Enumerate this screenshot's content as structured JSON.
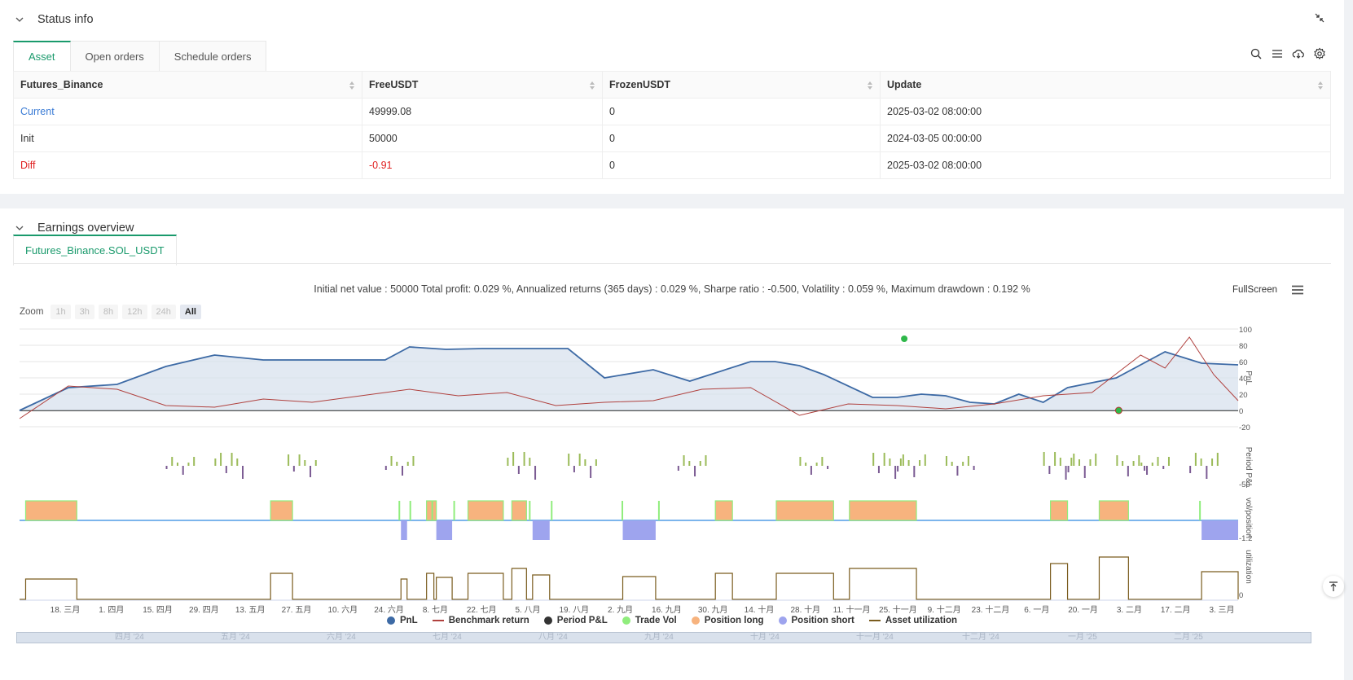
{
  "status_panel": {
    "title": "Status info",
    "tabs": [
      {
        "label": "Asset",
        "active": true
      },
      {
        "label": "Open orders",
        "active": false
      },
      {
        "label": "Schedule orders",
        "active": false
      }
    ],
    "toolbar_icons": [
      "search-icon",
      "list-icon",
      "cloud-download-icon",
      "gear-icon"
    ],
    "table": {
      "columns": [
        "Futures_Binance",
        "FreeUSDT",
        "FrozenUSDT",
        "Update"
      ],
      "rows": [
        {
          "label": "Current",
          "free": "49999.08",
          "frozen": "0",
          "update": "2025-03-02 08:00:00"
        },
        {
          "label": "Init",
          "free": "50000",
          "frozen": "0",
          "update": "2024-03-05 00:00:00"
        },
        {
          "label": "Diff",
          "free": "-0.91",
          "frozen": "0",
          "update": "2025-03-02 08:00:00"
        }
      ]
    }
  },
  "earnings_panel": {
    "title": "Earnings overview",
    "tab": "Futures_Binance.SOL_USDT",
    "summary": "Initial net value : 50000 Total profit: 0.029 %, Annualized returns (365 days) : 0.029 %, Sharpe ratio : -0.500, Volatility : 0.059 %, Maximum drawdown : 0.192 %",
    "fullscreen_label": "FullScreen",
    "zoom": {
      "label": "Zoom",
      "buttons": [
        "1h",
        "3h",
        "8h",
        "12h",
        "24h",
        "All"
      ],
      "active": "All"
    }
  },
  "colors": {
    "accent": "#1a9a6c",
    "pnl": "#3d6aa5",
    "benchmark": "#b0413e",
    "period_pos": "#9bbb59",
    "period_neg": "#7b5b93",
    "trade_vol": "#90ed7d",
    "position_long": "#f7b37e",
    "position_short": "#9ea4ee",
    "utilization": "#7a5c1e"
  },
  "chart_data": {
    "type": "line",
    "x_ticks": [
      "18. 三月",
      "1. 四月",
      "15. 四月",
      "29. 四月",
      "13. 五月",
      "27. 五月",
      "10. 六月",
      "24. 六月",
      "8. 七月",
      "22. 七月",
      "5. 八月",
      "19. 八月",
      "2. 九月",
      "16. 九月",
      "30. 九月",
      "14. 十月",
      "28. 十月",
      "11. 十一月",
      "25. 十一月",
      "9. 十二月",
      "23. 十二月",
      "6. 一月",
      "20. 一月",
      "3. 二月",
      "17. 二月",
      "3. 三月"
    ],
    "panes": [
      {
        "name": "PnL",
        "ylim": [
          -20,
          100
        ],
        "ticks": [
          "100",
          "80",
          "60",
          "40",
          "20",
          "0",
          "-20"
        ]
      },
      {
        "name": "Period P&L",
        "ticks": [
          "-50"
        ]
      },
      {
        "name": "vol/position",
        "ticks": [
          "-1.2"
        ]
      },
      {
        "name": "utilization",
        "ticks": [
          "0"
        ]
      }
    ],
    "series": [
      {
        "name": "PnL",
        "x": [
          0,
          4,
          8,
          12,
          16,
          20,
          22,
          26,
          28,
          30,
          32,
          35,
          38,
          40,
          42,
          45,
          48,
          52,
          55,
          60,
          62,
          64,
          66,
          70,
          72,
          74,
          76,
          78,
          80,
          82,
          84,
          86,
          90,
          94,
          97,
          100
        ],
        "y": [
          0,
          28,
          32,
          54,
          68,
          62,
          62,
          62,
          62,
          62,
          78,
          75,
          76,
          76,
          76,
          76,
          40,
          50,
          36,
          60,
          60,
          55,
          44,
          16,
          16,
          20,
          18,
          10,
          8,
          20,
          10,
          28,
          40,
          72,
          58,
          56
        ]
      },
      {
        "name": "Benchmark return",
        "x": [
          0,
          4,
          8,
          12,
          16,
          20,
          24,
          28,
          32,
          36,
          40,
          44,
          48,
          52,
          56,
          60,
          64,
          68,
          72,
          76,
          80,
          84,
          88,
          92,
          94,
          96,
          98,
          100
        ],
        "y": [
          -10,
          30,
          26,
          6,
          4,
          14,
          10,
          18,
          26,
          18,
          22,
          6,
          10,
          12,
          26,
          28,
          -6,
          8,
          6,
          2,
          8,
          18,
          22,
          68,
          52,
          90,
          44,
          12
        ]
      },
      {
        "name": "Period P&L",
        "x": [],
        "y": []
      },
      {
        "name": "Trade Vol",
        "x": [],
        "y": []
      },
      {
        "name": "Position long",
        "x": [],
        "y": []
      },
      {
        "name": "Position short",
        "x": [],
        "y": []
      },
      {
        "name": "Asset utilization",
        "x": [],
        "y": []
      }
    ],
    "navigator_labels": [
      "四月 '24",
      "五月 '24",
      "六月 '24",
      "七月 '24",
      "八月 '24",
      "九月 '24",
      "十月 '24",
      "十一月 '24",
      "十二月 '24",
      "一月 '25",
      "二月 '25"
    ]
  }
}
